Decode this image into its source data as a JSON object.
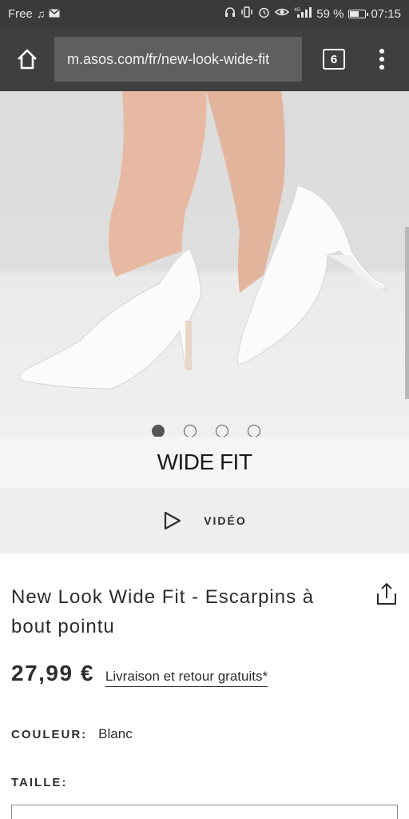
{
  "status_bar": {
    "carrier": "Free",
    "battery_percent": "59 %",
    "time": "07:15",
    "icons": [
      "music-note-icon",
      "mail-icon",
      "headphones-icon",
      "vibrate-icon",
      "alarm-icon",
      "eye-icon",
      "signal-icon",
      "battery-icon"
    ]
  },
  "browser": {
    "url": "m.asos.com/fr/new-look-wide-fit",
    "tab_count": "6",
    "icons": [
      "home-icon",
      "tabs-icon",
      "menu-icon"
    ]
  },
  "gallery": {
    "dots": 4,
    "active_index": 0,
    "banner": "WIDE FIT"
  },
  "video": {
    "label": "VIDÉO",
    "icon": "play-icon"
  },
  "product": {
    "title_line1": "New Look Wide Fit - Escarpins à",
    "title_line2": "bout pointu",
    "price": "27,99 €",
    "delivery": "Livraison et retour gratuits*",
    "color_label": "COULEUR:",
    "color_value": "Blanc",
    "size_label": "TAILLE:",
    "share_icon": "share-icon"
  },
  "colors": {
    "status_bar_bg": "#3a3a3a",
    "toolbar_bg": "#3f3f3f",
    "url_bar_bg": "#5f5f5f",
    "text": "#2d2d2d"
  }
}
